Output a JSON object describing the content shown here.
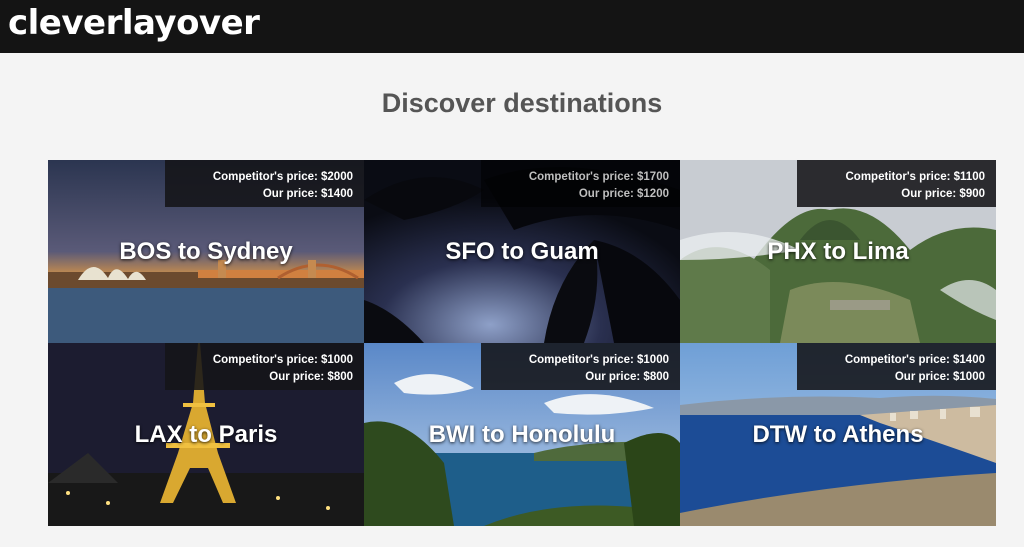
{
  "header": {
    "brand": "cleverlayover"
  },
  "page": {
    "title": "Discover destinations"
  },
  "destinations": [
    {
      "route": "BOS to Sydney",
      "competitor": "Competitor's price: $2000",
      "ours": "Our price: $1400"
    },
    {
      "route": "SFO to Guam",
      "competitor": "Competitor's price: $1700",
      "ours": "Our price: $1200"
    },
    {
      "route": "PHX to Lima",
      "competitor": "Competitor's price: $1100",
      "ours": "Our price: $900"
    },
    {
      "route": "LAX to Paris",
      "competitor": "Competitor's price: $1000",
      "ours": "Our price: $800"
    },
    {
      "route": "BWI to Honolulu",
      "competitor": "Competitor's price: $1000",
      "ours": "Our price: $800"
    },
    {
      "route": "DTW to Athens",
      "competitor": "Competitor's price: $1400",
      "ours": "Our price: $1000"
    }
  ],
  "colors": {
    "topbar": "#141414",
    "heading": "#555555",
    "page_bg": "#f4f4f4"
  }
}
